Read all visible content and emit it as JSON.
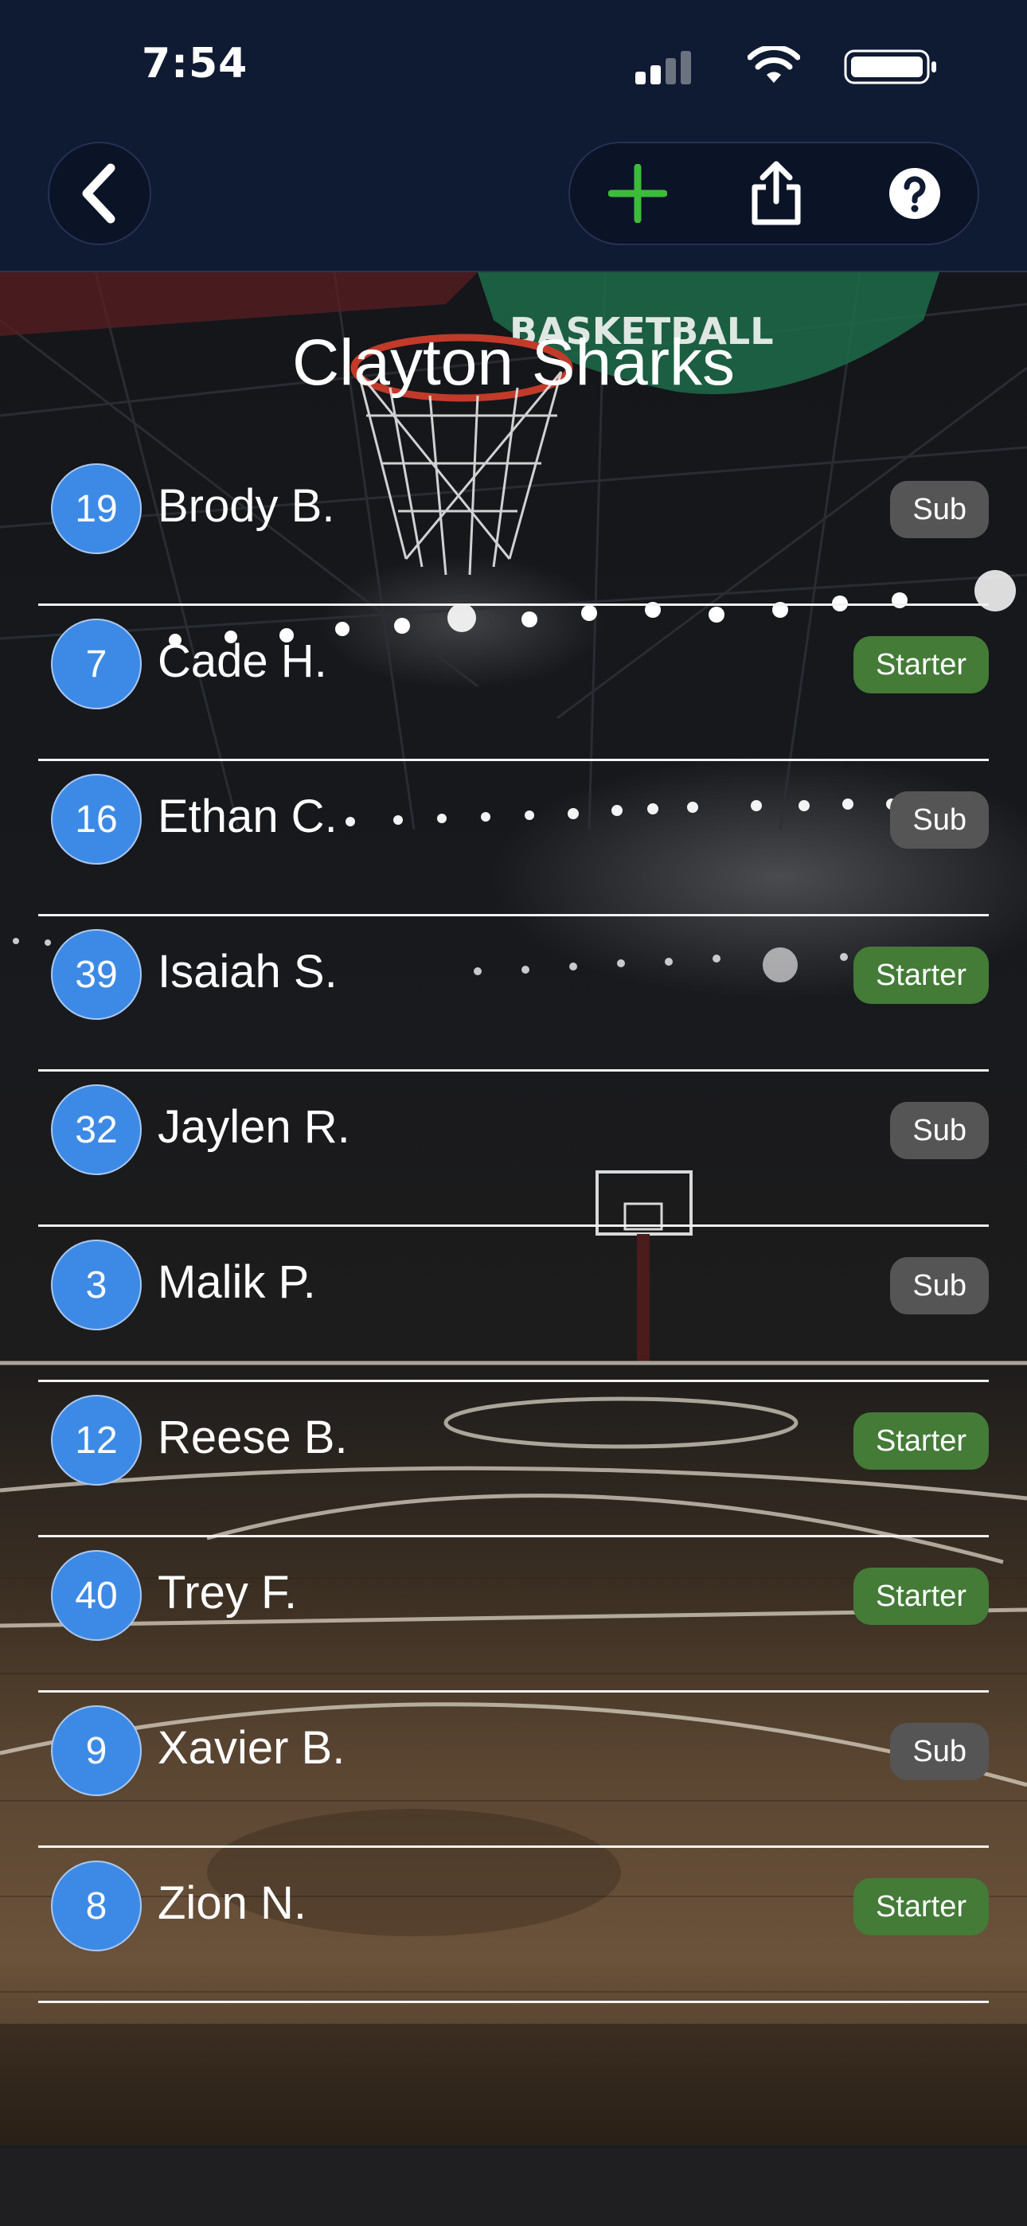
{
  "status_bar": {
    "time": "7:54"
  },
  "toolbar": {
    "back_icon": "chevron-left-icon",
    "add_icon": "plus-icon",
    "share_icon": "share-icon",
    "help_icon": "question-circle-icon",
    "add_color": "#3dbb3a"
  },
  "background": {
    "sign_text": "BASKETBALL"
  },
  "team": {
    "name": "Clayton Sharks"
  },
  "colors": {
    "number_circle": "#3d8ae6",
    "sub_badge": "#555555",
    "starter_badge": "#437b37",
    "header": "#0f1a33"
  },
  "players": [
    {
      "number": "19",
      "name": "Brody B.",
      "role": "Sub"
    },
    {
      "number": "7",
      "name": "Cade H.",
      "role": "Starter"
    },
    {
      "number": "16",
      "name": "Ethan C.",
      "role": "Sub"
    },
    {
      "number": "39",
      "name": "Isaiah S.",
      "role": "Starter"
    },
    {
      "number": "32",
      "name": "Jaylen R.",
      "role": "Sub"
    },
    {
      "number": "3",
      "name": "Malik P.",
      "role": "Sub"
    },
    {
      "number": "12",
      "name": "Reese B.",
      "role": "Starter"
    },
    {
      "number": "40",
      "name": "Trey F.",
      "role": "Starter"
    },
    {
      "number": "9",
      "name": "Xavier B.",
      "role": "Sub"
    },
    {
      "number": "8",
      "name": "Zion N.",
      "role": "Starter"
    }
  ]
}
